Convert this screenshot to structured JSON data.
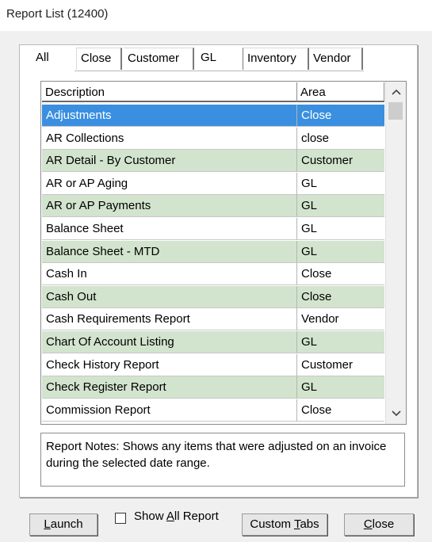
{
  "window": {
    "title": "Report List (12400)"
  },
  "tabs": [
    "All",
    "Close",
    "Customer",
    "GL",
    "Inventory",
    "Vendor"
  ],
  "grid": {
    "columns": [
      "Description",
      "Area"
    ],
    "rows": [
      {
        "description": "Adjustments",
        "area": "Close"
      },
      {
        "description": "AR Collections",
        "area": "close"
      },
      {
        "description": "AR Detail - By Customer",
        "area": "Customer"
      },
      {
        "description": "AR or AP Aging",
        "area": "GL"
      },
      {
        "description": "AR or AP Payments",
        "area": "GL"
      },
      {
        "description": "Balance Sheet",
        "area": "GL"
      },
      {
        "description": "Balance Sheet - MTD",
        "area": "GL"
      },
      {
        "description": "Cash In",
        "area": "Close"
      },
      {
        "description": "Cash Out",
        "area": "Close"
      },
      {
        "description": "Cash Requirements Report",
        "area": "Vendor"
      },
      {
        "description": "Chart Of Account Listing",
        "area": "GL"
      },
      {
        "description": "Check History Report",
        "area": "Customer"
      },
      {
        "description": "Check Register Report",
        "area": "GL"
      },
      {
        "description": "Commission Report",
        "area": "Close"
      }
    ],
    "selected_index": 0
  },
  "notes": {
    "text": "Report Notes:  Shows any items that were adjusted on an invoice during the selected date range."
  },
  "buttons": {
    "launch": {
      "pre": "",
      "key": "L",
      "post": "aunch"
    },
    "custom_tabs": {
      "pre": "Custom ",
      "key": "T",
      "post": "abs"
    },
    "close": {
      "pre": "",
      "key": "C",
      "post": "lose"
    }
  },
  "show_all": {
    "pre": "Show ",
    "key": "A",
    "post": "ll Report",
    "checked": false
  },
  "icons": {
    "scroll_up": "chevron-up-icon",
    "scroll_down": "chevron-down-icon"
  }
}
